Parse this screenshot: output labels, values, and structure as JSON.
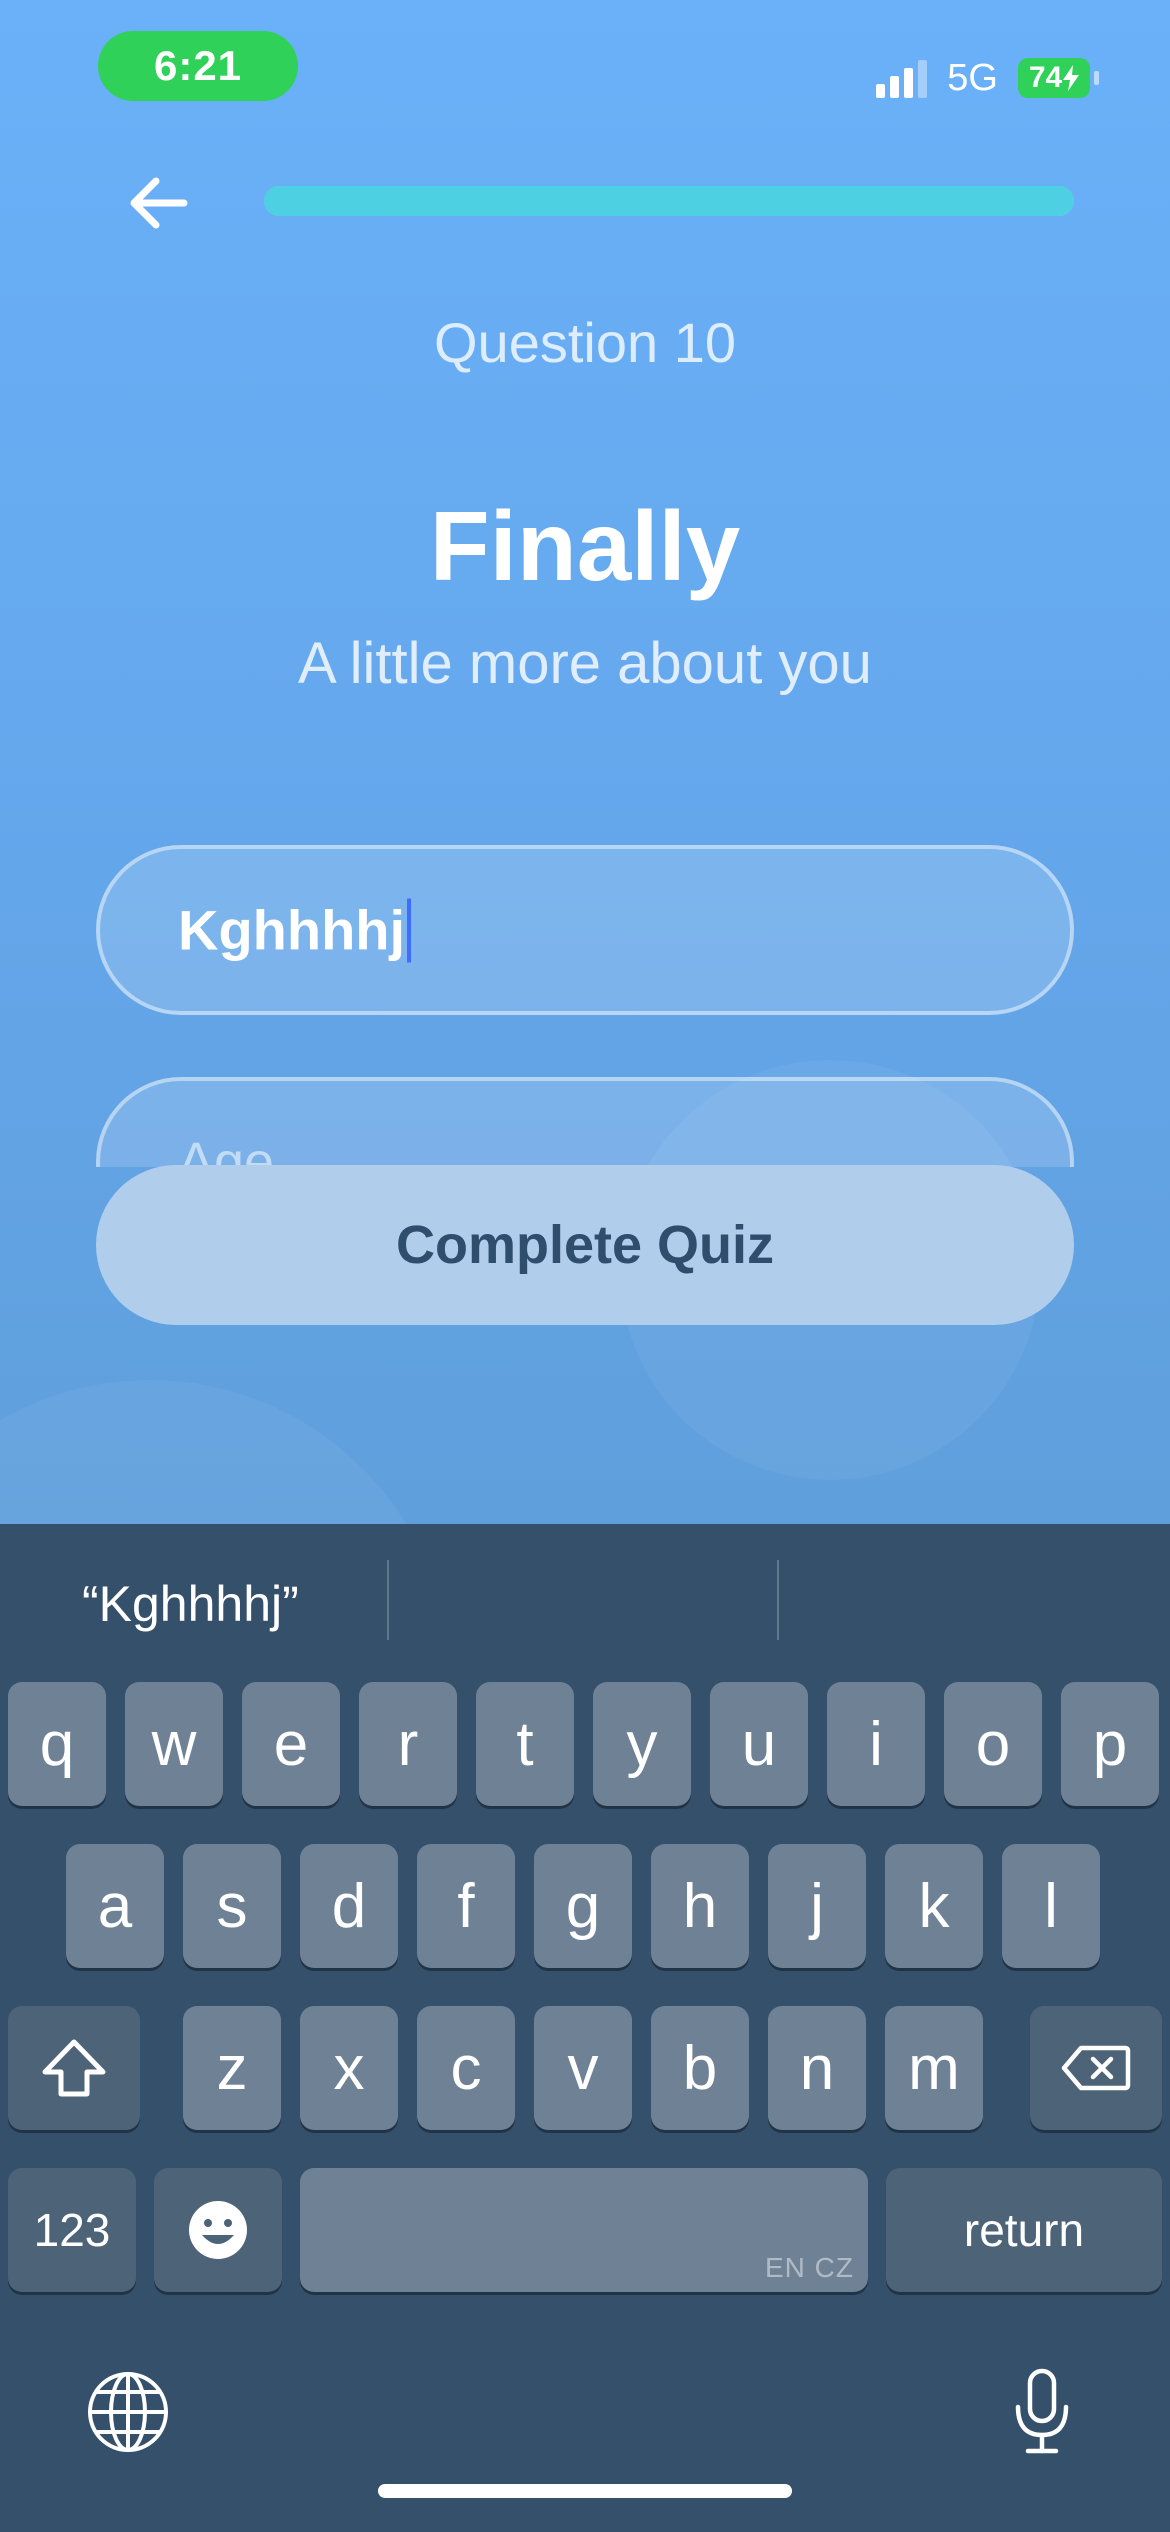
{
  "status_bar": {
    "time": "6:21",
    "network": "5G",
    "battery": "74"
  },
  "header": {
    "progress_percent": 100
  },
  "question_label": "Question 10",
  "title": "Finally",
  "subtitle": "A little more about you",
  "name_field": {
    "value": "Kghhhhj"
  },
  "age_field": {
    "placeholder": "Age"
  },
  "complete_button": "Complete Quiz",
  "keyboard": {
    "suggestion": "“Kghhhhj”",
    "row1": [
      "q",
      "w",
      "e",
      "r",
      "t",
      "y",
      "u",
      "i",
      "o",
      "p"
    ],
    "row2": [
      "a",
      "s",
      "d",
      "f",
      "g",
      "h",
      "j",
      "k",
      "l"
    ],
    "row3": [
      "z",
      "x",
      "c",
      "v",
      "b",
      "n",
      "m"
    ],
    "numbers_key": "123",
    "return_key": "return",
    "space_language": "EN CZ"
  }
}
